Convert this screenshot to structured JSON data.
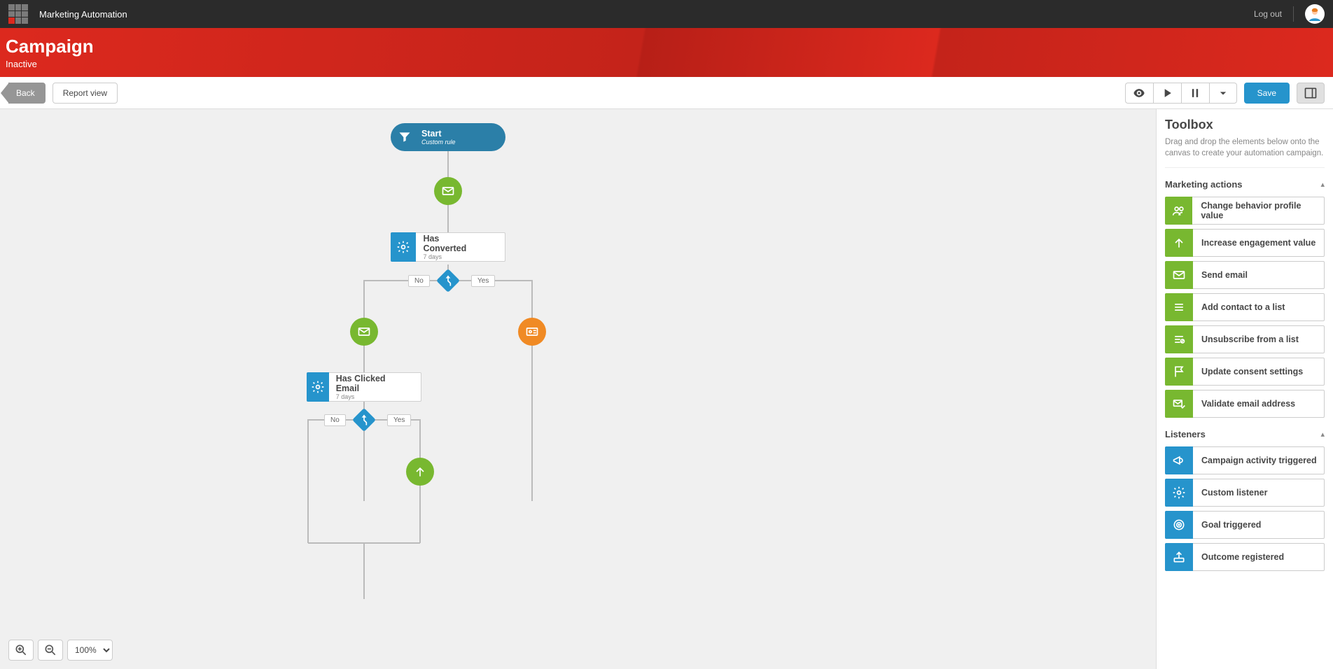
{
  "header": {
    "brand": "Marketing Automation",
    "logout": "Log out"
  },
  "page": {
    "title": "Campaign",
    "status": "Inactive"
  },
  "actionbar": {
    "back": "Back",
    "report_view": "Report view",
    "save": "Save"
  },
  "zoom": {
    "value": "100%"
  },
  "flow": {
    "start": {
      "title": "Start",
      "subtitle": "Custom rule"
    },
    "has_converted": {
      "title": "Has Converted",
      "subtitle": "7 days"
    },
    "has_clicked": {
      "title": "Has Clicked Email",
      "subtitle": "7 days"
    },
    "yes": "Yes",
    "no": "No"
  },
  "toolbox": {
    "title": "Toolbox",
    "description": "Drag and drop the elements below onto the canvas to create your automation campaign.",
    "sections": {
      "marketing_actions": {
        "label": "Marketing actions",
        "items": [
          "Change behavior profile value",
          "Increase engagement value",
          "Send email",
          "Add contact to a list",
          "Unsubscribe from a list",
          "Update consent settings",
          "Validate email address"
        ]
      },
      "listeners": {
        "label": "Listeners",
        "items": [
          "Campaign activity triggered",
          "Custom listener",
          "Goal triggered",
          "Outcome registered"
        ]
      }
    }
  }
}
